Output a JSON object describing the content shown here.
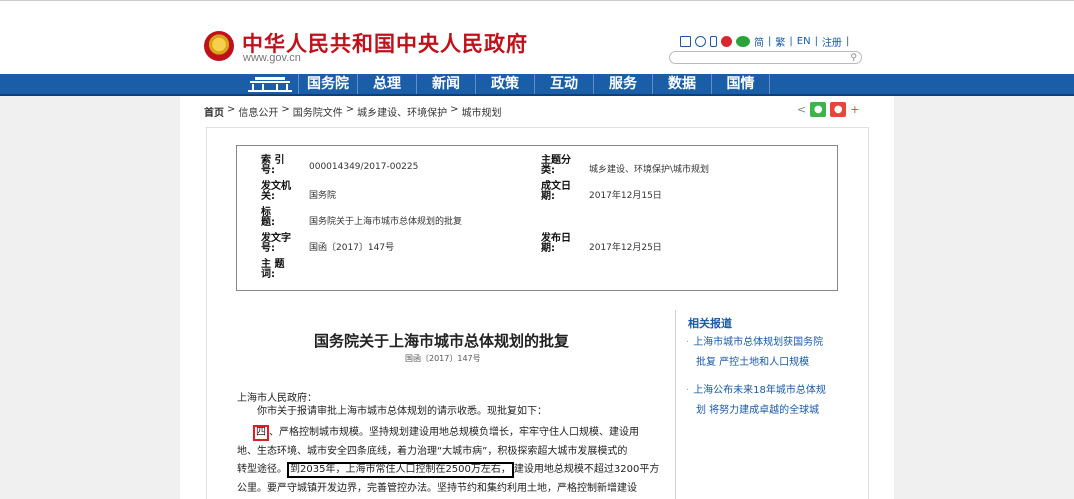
{
  "header": {
    "site_title": "中华人民共和国中央人民政府",
    "site_url": "www.gov.cn",
    "lang_links": [
      "简",
      "繁",
      "EN",
      "注册"
    ],
    "search_placeholder": ""
  },
  "nav": {
    "items": [
      "国务院",
      "总理",
      "新闻",
      "政策",
      "互动",
      "服务",
      "数据",
      "国情"
    ]
  },
  "breadcrumb": [
    "首页",
    "信息公开",
    "国务院文件",
    "城乡建设、环境保护",
    "城市规划"
  ],
  "breadcrumb_sep": ">",
  "meta": {
    "index_label": "索 引 号:",
    "index_value": "000014349/2017-00225",
    "topic_label": "主题分类:",
    "topic_value": "城乡建设、环境保护\\城市规划",
    "issuer_label": "发文机关:",
    "issuer_value": "国务院",
    "date_label": "成文日期:",
    "date_value": "2017年12月15日",
    "title_label": "标　　题:",
    "title_value": "国务院关于上海市城市总体规划的批复",
    "docno_label": "发文字号:",
    "docno_value": "国函〔2017〕147号",
    "pubdate_label": "发布日期:",
    "pubdate_value": "2017年12月25日",
    "keywords_label": "主 题 词:"
  },
  "article": {
    "title": "国务院关于上海市城市总体规划的批复",
    "doc_no": "国函〔2017〕147号",
    "addressee": "上海市人民政府：",
    "p1": "你市关于报请审批上海市城市总体规划的请示收悉。现批复如下：",
    "p2_num": "四",
    "p2_rest": "、严格控制城市规模。坚持规划建设用地总规模负增长，牢牢守住人口规模、建设用",
    "p3": "地、生态环境、城市安全四条底线，着力治理“大城市病”，积极探索超大城市发展模式的",
    "p4_pre": "转型途径。",
    "p4_box": "到2035年，上海市常住人口控制在2500万左右，",
    "p4_post": "建设用地总规模不超过3200平方",
    "p5": "公里。要严守城镇开发边界，完善管控办法。坚持节约和集约利用土地，严格控制新增建设"
  },
  "related": {
    "title": "相关报道",
    "items": [
      {
        "line1": "上海市城市总体规划获国务院",
        "line2": "批复 严控土地和人口规模"
      },
      {
        "line1": "上海公布未来18年城市总体规",
        "line2": "划 将努力建成卓越的全球城"
      }
    ]
  }
}
